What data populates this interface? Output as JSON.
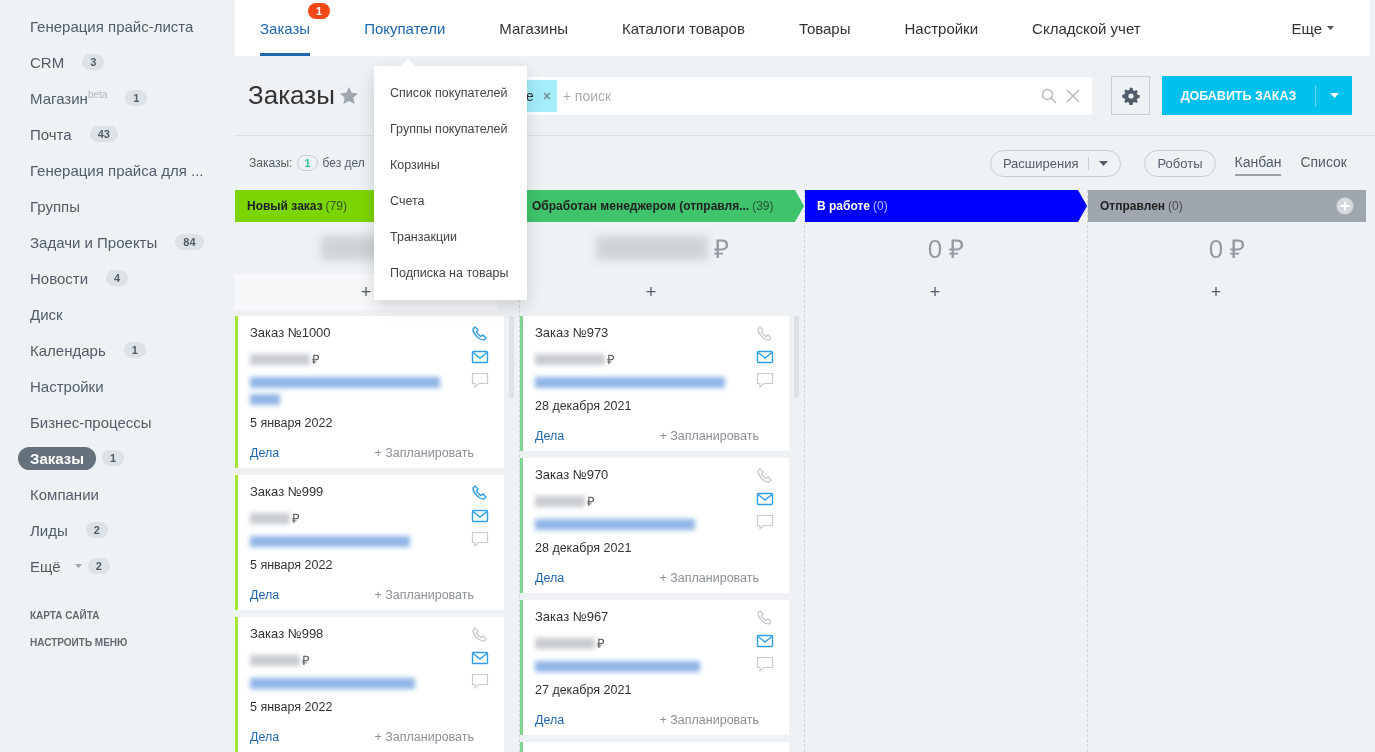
{
  "sidebar": {
    "items": [
      {
        "label": "Генерация прайс-листа",
        "selected": false
      },
      {
        "label": "CRM",
        "counter": "3",
        "selected": false
      },
      {
        "label": "Магазин$^{beta}$",
        "counter": "1",
        "selected": false
      },
      {
        "label": "Почта",
        "counter": "43",
        "selected": false
      },
      {
        "label": "Генерация прайса для ...",
        "selected": false
      },
      {
        "label": "Группы",
        "selected": false
      },
      {
        "label": "Задачи и Проекты",
        "counter": "84",
        "selected": false
      },
      {
        "label": "Новости",
        "counter": "4",
        "selected": false
      },
      {
        "label": "Диск",
        "selected": false
      },
      {
        "label": "Календарь",
        "counter": "1",
        "selected": false
      },
      {
        "label": "Настройки",
        "selected": false
      },
      {
        "label": "Бизнес-процессы",
        "selected": false
      },
      {
        "label": "Заказы",
        "counter": "1",
        "selected": true
      },
      {
        "label": "Компании",
        "selected": false
      },
      {
        "label": "Лиды",
        "counter": "2",
        "selected": false
      },
      {
        "label": "Ещё",
        "counter": "2",
        "has_caret": true,
        "selected": false
      }
    ],
    "footer_links": [
      "КАРТА САЙТА",
      "НАСТРОИТЬ МЕНЮ"
    ]
  },
  "top_nav": {
    "tabs": [
      {
        "label": "Заказы",
        "badge": "1",
        "selected": true
      },
      {
        "label": "Покупатели",
        "selected": false,
        "hovered": true
      },
      {
        "label": "Магазины",
        "selected": false
      },
      {
        "label": "Каталоги товаров",
        "selected": false
      },
      {
        "label": "Товары",
        "selected": false
      },
      {
        "label": "Настройки",
        "selected": false
      },
      {
        "label": "Складской учет",
        "selected": false
      }
    ],
    "more": "Еще"
  },
  "dropdown_menu": [
    "Список покупателей",
    "Группы покупателей",
    "Корзины",
    "Счета",
    "Транзакции",
    "Подписка на товары"
  ],
  "header": {
    "title": "Заказы",
    "filter_tag": "е",
    "search_placeholder": "+ поиск",
    "add_button": "ДОБАВИТЬ ЗАКАЗ"
  },
  "toolbar": {
    "label": "Заказы:",
    "counter": "1",
    "counter_text": "без дел",
    "extensions": "Расширения",
    "robots": "Роботы",
    "views": [
      {
        "label": "Канбан",
        "selected": true
      },
      {
        "label": "Список",
        "selected": false
      }
    ]
  },
  "kanban": {
    "columns": [
      {
        "title": "Новый заказ",
        "count": "(79)",
        "color": "#7bd500",
        "sum": {
          "kind": "redacted"
        },
        "add": "+",
        "cards": [
          {
            "title": "Заказ №1000",
            "currency": "₽",
            "date": "5 января 2022",
            "phone_active": true,
            "client_wrapped": true,
            "link": "Дела",
            "plan": "+ Запланировать"
          },
          {
            "title": "Заказ №999",
            "currency": "₽",
            "date": "5 января 2022",
            "phone_active": true,
            "client_wrapped": false,
            "link": "Дела",
            "plan": "+ Запланировать"
          },
          {
            "title": "Заказ №998",
            "currency": "₽",
            "date": "5 января 2022",
            "phone_active": false,
            "client_wrapped": false,
            "link": "Дела",
            "plan": "+ Запланировать"
          }
        ]
      },
      {
        "title": "Обработан менеджером (отправля...",
        "count": "(39)",
        "color": "#3fc46b",
        "sum": {
          "kind": "redacted",
          "currency": "₽"
        },
        "add": "+",
        "cards": [
          {
            "title": "Заказ №973",
            "currency": "₽",
            "date": "28 декабря 2021",
            "phone_active": false,
            "client_wrapped": false,
            "link": "Дела",
            "plan": "+ Запланировать"
          },
          {
            "title": "Заказ №970",
            "currency": "₽",
            "date": "28 декабря 2021",
            "phone_active": false,
            "client_wrapped": false,
            "link": "Дела",
            "plan": "+ Запланировать"
          },
          {
            "title": "Заказ №967",
            "currency": "₽",
            "date": "27 декабря 2021",
            "phone_active": false,
            "client_wrapped": false,
            "link": "Дела",
            "plan": "+ Запланировать"
          }
        ]
      },
      {
        "title": "В работе",
        "count": "(0)",
        "color": "#0000ff",
        "sum": {
          "kind": "plain",
          "text": "0 ₽"
        },
        "add": "+"
      },
      {
        "title": "Отправлен",
        "count": "(0)",
        "color": "#a0a6ad",
        "sum": {
          "kind": "plain",
          "text": "0 ₽"
        },
        "add": "+"
      }
    ]
  }
}
